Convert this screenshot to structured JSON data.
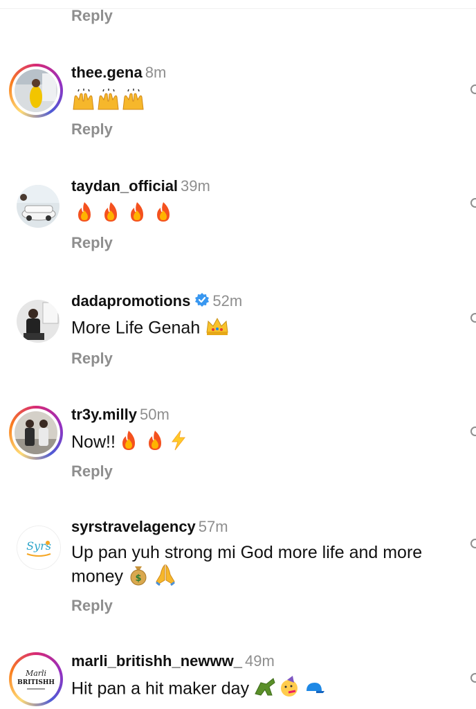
{
  "reply_label": "Reply",
  "comments": [
    {
      "username": "thee.gena",
      "time": "8m",
      "text": "",
      "emojis": [
        "raising-hands",
        "raising-hands",
        "raising-hands"
      ]
    },
    {
      "username": "taydan_official",
      "time": "39m",
      "text": "",
      "emojis": [
        "fire",
        "fire",
        "fire",
        "fire"
      ]
    },
    {
      "username": "dadapromotions",
      "time": "52m",
      "verified": true,
      "text": "More Life Genah",
      "emojis": [
        "crown"
      ]
    },
    {
      "username": "tr3y.milly",
      "time": "50m",
      "text": "Now!!",
      "emojis": [
        "fire",
        "fire",
        "lightning"
      ]
    },
    {
      "username": "syrstravelagency",
      "time": "57m",
      "text": "Up pan yuh strong mi God more life and more money",
      "emojis": [
        "money-bag",
        "folded-hands"
      ]
    },
    {
      "username": "marli_britishh_newww_",
      "time": "49m",
      "text": "Hit pan a hit maker day",
      "emojis": [
        "crocodile",
        "partying-face",
        "cap"
      ]
    }
  ],
  "colors": {
    "secondary_text": "#8e8e8e",
    "verified": "#3897f0"
  }
}
